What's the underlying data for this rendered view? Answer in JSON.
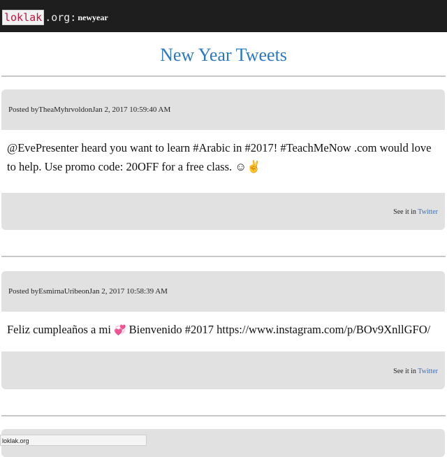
{
  "header": {
    "logo_box": "loklak",
    "logo_rest": ".org:",
    "logo_suffix": "newyear"
  },
  "page_title": "New Year Tweets",
  "tweets": [
    {
      "posted_prefix": "Posted by ",
      "author": "TheaMyhrvold",
      "date_prefix": " on ",
      "date": "Jan 2, 2017 10:59:40 AM",
      "text": "@EvePresenter heard you want to learn #Arabic in #2017! #TeachMeNow .com would love to help. Use promo code: 20OFF for a free class. ☺✌",
      "see_it_in": "See it in",
      "link_label": "Twitter"
    },
    {
      "posted_prefix": "Posted by ",
      "author": "EsmirnaUribe",
      "date_prefix": " on ",
      "date": "Jan 2, 2017 10:58:39 AM",
      "text_before": "Feliz cumpleaños a mi ",
      "emoji": "💞",
      "text_after": " Bienvenido #2017 https://www.instagram.com/p/BOv9XnllGFO/",
      "see_it_in": "See it in",
      "link_label": "Twitter"
    }
  ],
  "status_bar": {
    "url": "loklak.org"
  }
}
